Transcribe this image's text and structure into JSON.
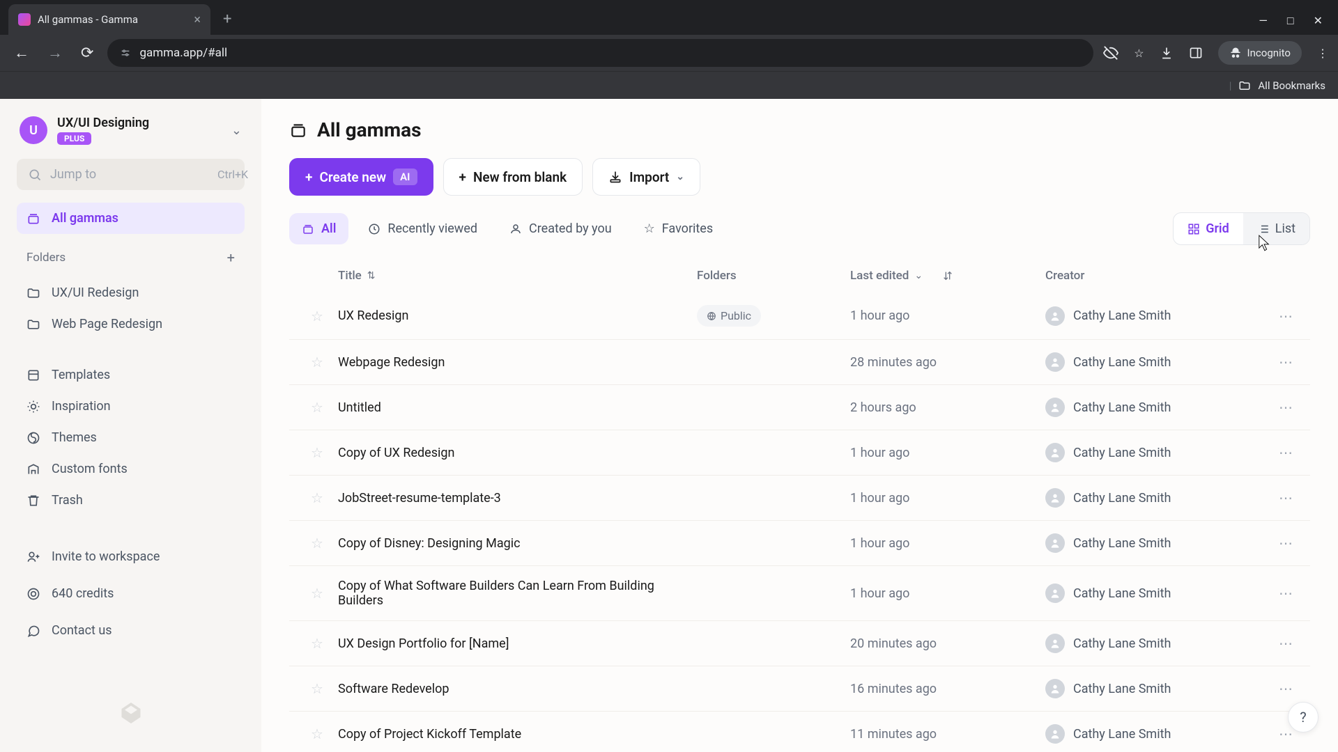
{
  "browser": {
    "tab_title": "All gammas - Gamma",
    "url": "gamma.app/#all",
    "incognito": "Incognito",
    "bookmarks": "All Bookmarks"
  },
  "sidebar": {
    "workspace": {
      "initial": "U",
      "name": "UX/UI Designing",
      "badge": "PLUS"
    },
    "search": {
      "placeholder": "Jump to",
      "shortcut": "Ctrl+K"
    },
    "nav_all": "All gammas",
    "folders_header": "Folders",
    "folders": [
      {
        "label": "UX/UI Redesign"
      },
      {
        "label": "Web Page Redesign"
      }
    ],
    "utility": [
      {
        "label": "Templates"
      },
      {
        "label": "Inspiration"
      },
      {
        "label": "Themes"
      },
      {
        "label": "Custom fonts"
      },
      {
        "label": "Trash"
      }
    ],
    "invite": "Invite to workspace",
    "credits": "640 credits",
    "contact": "Contact us"
  },
  "main": {
    "title": "All gammas",
    "actions": {
      "create": "Create new",
      "ai": "AI",
      "blank": "New from blank",
      "import": "Import"
    },
    "filters": {
      "all": "All",
      "recent": "Recently viewed",
      "created": "Created by you",
      "favorites": "Favorites"
    },
    "view": {
      "grid": "Grid",
      "list": "List"
    },
    "columns": {
      "title": "Title",
      "folders": "Folders",
      "last_edited": "Last edited",
      "creator": "Creator"
    },
    "rows": [
      {
        "title": "UX Redesign",
        "folder_badge": "Public",
        "last_edited": "1 hour ago",
        "creator": "Cathy Lane Smith"
      },
      {
        "title": "Webpage Redesign",
        "folder_badge": "",
        "last_edited": "28 minutes ago",
        "creator": "Cathy Lane Smith"
      },
      {
        "title": "Untitled",
        "folder_badge": "",
        "last_edited": "2 hours ago",
        "creator": "Cathy Lane Smith"
      },
      {
        "title": "Copy of UX Redesign",
        "folder_badge": "",
        "last_edited": "1 hour ago",
        "creator": "Cathy Lane Smith"
      },
      {
        "title": "JobStreet-resume-template-3",
        "folder_badge": "",
        "last_edited": "1 hour ago",
        "creator": "Cathy Lane Smith"
      },
      {
        "title": "Copy of Disney: Designing Magic",
        "folder_badge": "",
        "last_edited": "1 hour ago",
        "creator": "Cathy Lane Smith"
      },
      {
        "title": "Copy of What Software Builders Can Learn From Building Builders",
        "folder_badge": "",
        "last_edited": "1 hour ago",
        "creator": "Cathy Lane Smith"
      },
      {
        "title": "UX Design Portfolio for [Name]",
        "folder_badge": "",
        "last_edited": "20 minutes ago",
        "creator": "Cathy Lane Smith"
      },
      {
        "title": "Software Redevelop",
        "folder_badge": "",
        "last_edited": "16 minutes ago",
        "creator": "Cathy Lane Smith"
      },
      {
        "title": "Copy of Project Kickoff Template",
        "folder_badge": "",
        "last_edited": "11 minutes ago",
        "creator": "Cathy Lane Smith"
      }
    ]
  }
}
